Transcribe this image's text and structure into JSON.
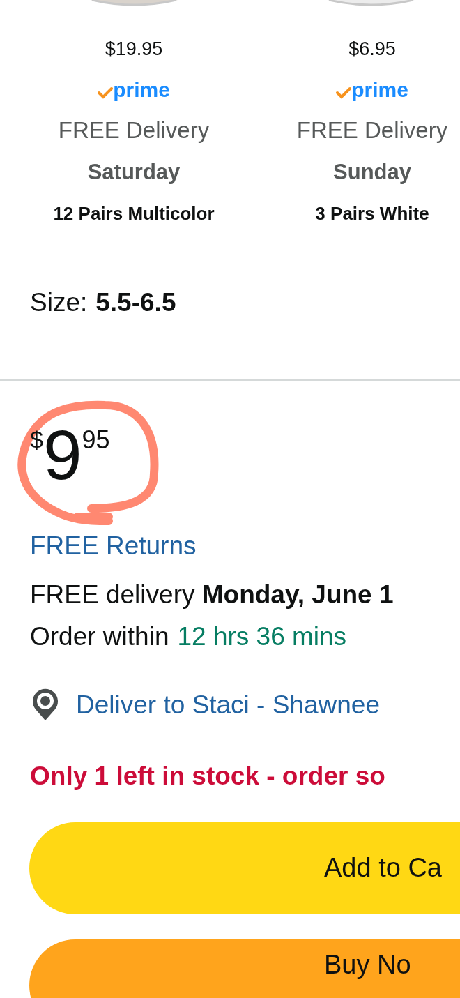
{
  "options": [
    {
      "price": "$19.95",
      "badge": "prime",
      "delivery": "FREE Delivery",
      "day": "Saturday",
      "variant": "12 Pairs Multicolor"
    },
    {
      "price": "$6.95",
      "badge": "prime",
      "delivery": "FREE Delivery",
      "day": "Sunday",
      "variant": "3 Pairs White"
    }
  ],
  "size": {
    "label": "Size:",
    "value": "5.5-6.5"
  },
  "price": {
    "symbol": "$",
    "whole": "9",
    "fraction": "95",
    "circled": true
  },
  "returns": "FREE Returns",
  "delivery": "FREE delivery **Monday, June 1**",
  "order_within": {
    "label": "Order within",
    "time": "12 hrs 36 mins"
  },
  "deliver_to": "Deliver to Staci - Shawnee",
  "stock": "Only 1 left in stock - order so",
  "buttons": [
    {
      "kind": "cart",
      "label": "Add to Ca"
    },
    {
      "kind": "buy",
      "label": "Buy No"
    }
  ]
}
